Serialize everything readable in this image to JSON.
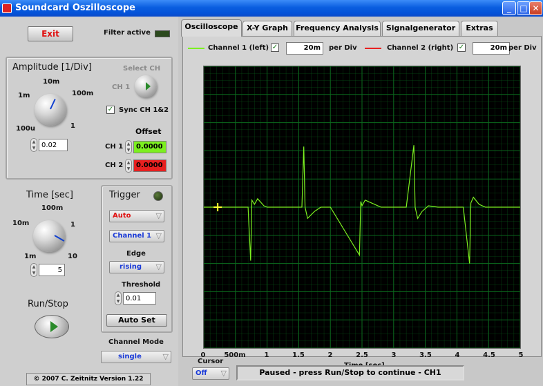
{
  "window": {
    "title": "Soundcard Oszilloscope"
  },
  "left": {
    "exit_label": "Exit",
    "filter_label": "Filter active",
    "amplitude": {
      "title": "Amplitude [1/Div]",
      "scale": [
        "10m",
        "1m",
        "100m",
        "100u",
        "1"
      ],
      "value": "0.02"
    },
    "select_ch": {
      "title": "Select CH",
      "ch_label": "CH 1"
    },
    "sync_label": "Sync CH 1&2",
    "offset": {
      "title": "Offset",
      "ch1_label": "CH 1",
      "ch1_value": "0.0000",
      "ch2_label": "CH 2",
      "ch2_value": "0.0000"
    },
    "time": {
      "title": "Time [sec]",
      "scale": [
        "100m",
        "10m",
        "1",
        "1m",
        "10"
      ],
      "value": "5"
    },
    "trigger": {
      "title": "Trigger",
      "mode": "Auto",
      "channel": "Channel 1",
      "edge_label": "Edge",
      "edge": "rising",
      "threshold_label": "Threshold",
      "threshold": "0.01",
      "autoset_label": "Auto Set"
    },
    "run_stop_label": "Run/Stop",
    "channel_mode_label": "Channel Mode",
    "channel_mode": "single",
    "copyright": "© 2007  C. Zeitnitz Version 1.22"
  },
  "tabs": [
    "Oscilloscope",
    "X-Y Graph",
    "Frequency Analysis",
    "Signalgenerator",
    "Extras"
  ],
  "channels": {
    "ch1_label": "Channel 1 (left)",
    "ch1_value": "20m",
    "ch2_label": "Channel 2 (right)",
    "ch2_value": "20m",
    "per_div": "per Div"
  },
  "cursor": {
    "label": "Cursor",
    "value": "Off"
  },
  "status": "Paused - press Run/Stop to continue - CH1",
  "colors": {
    "ch1": "#7cf020",
    "ch2": "#e82020",
    "grid": "#0b6b1e",
    "plot_bg": "#000000"
  },
  "chart_data": {
    "type": "line",
    "xlabel": "Time [sec]",
    "xlim": [
      0,
      5
    ],
    "x_ticks": [
      "0",
      "500m",
      "1",
      "1.5",
      "2",
      "2.5",
      "3",
      "3.5",
      "4",
      "4.5",
      "5"
    ],
    "ylim": [
      -10,
      10
    ],
    "series": [
      {
        "name": "Channel 1 (left)",
        "x": [
          0,
          0.7,
          0.74,
          0.76,
          0.8,
          0.85,
          0.95,
          1.0,
          1.55,
          1.58,
          1.6,
          1.64,
          1.75,
          1.85,
          2.0,
          2.46,
          2.48,
          2.5,
          2.55,
          2.65,
          2.8,
          3.2,
          3.32,
          3.34,
          3.38,
          3.45,
          3.55,
          3.7,
          4.1,
          4.2,
          4.22,
          4.26,
          4.35,
          4.45,
          5.0
        ],
        "y": [
          0,
          0,
          -3.8,
          0.5,
          0.2,
          0.6,
          0.1,
          0,
          0,
          4.3,
          0,
          -0.8,
          -0.3,
          0,
          0,
          -3.4,
          0.4,
          0.1,
          0.5,
          0.3,
          0,
          0,
          4.4,
          0,
          -0.8,
          -0.3,
          0.1,
          0,
          0,
          -4.0,
          0.3,
          0.7,
          0.2,
          0,
          0
        ]
      }
    ]
  }
}
